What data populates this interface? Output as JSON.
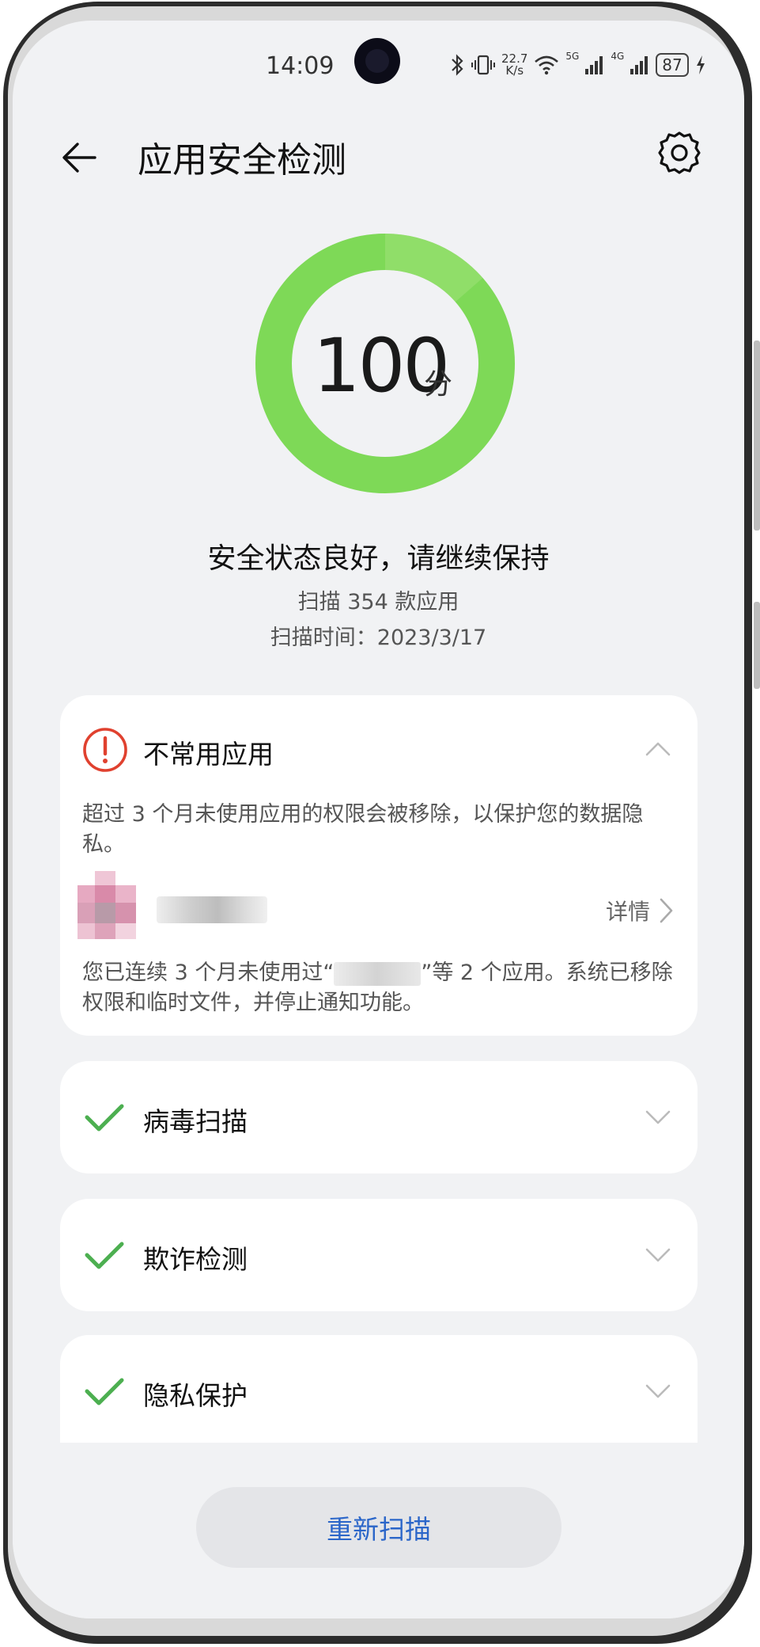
{
  "status_bar": {
    "time": "14:09",
    "net_speed_value": "22.7",
    "net_speed_unit": "K/s",
    "sim1": "5G",
    "sim2": "4G",
    "battery": "87",
    "icons": [
      "bluetooth-icon",
      "vibrate-icon",
      "wifi-icon",
      "signal-icon",
      "charging-icon"
    ]
  },
  "header": {
    "title": "应用安全检测",
    "back_icon": "back-arrow-icon",
    "settings_icon": "gear-icon"
  },
  "score": {
    "value": "100",
    "unit": "分",
    "progress_fraction": 1.0,
    "ring_color": "#7ed957",
    "message": "安全状态良好，请继续保持",
    "scan_count": "扫描 354 款应用",
    "scan_time": "扫描时间：2023/3/17"
  },
  "cards": {
    "unused": {
      "title": "不常用应用",
      "icon": "warning-icon",
      "icon_color": "#e0412f",
      "description": "超过 3 个月未使用应用的权限会被移除，以保护您的数据隐私。",
      "details_label": "详情",
      "notice_prefix": "您已连续 3 个月未使用过“",
      "notice_suffix": "”等 2 个应用。系统已移除权限和临时文件，并停止通知功能。",
      "expanded": true
    },
    "virus": {
      "title": "病毒扫描",
      "icon": "check-icon"
    },
    "fraud": {
      "title": "欺诈检测",
      "icon": "check-icon"
    },
    "privacy": {
      "title": "隐私保护",
      "icon": "check-icon"
    },
    "check_color": "#4caf50"
  },
  "footer": {
    "rescan_label": "重新扫描",
    "accent": "#2b66c9"
  }
}
